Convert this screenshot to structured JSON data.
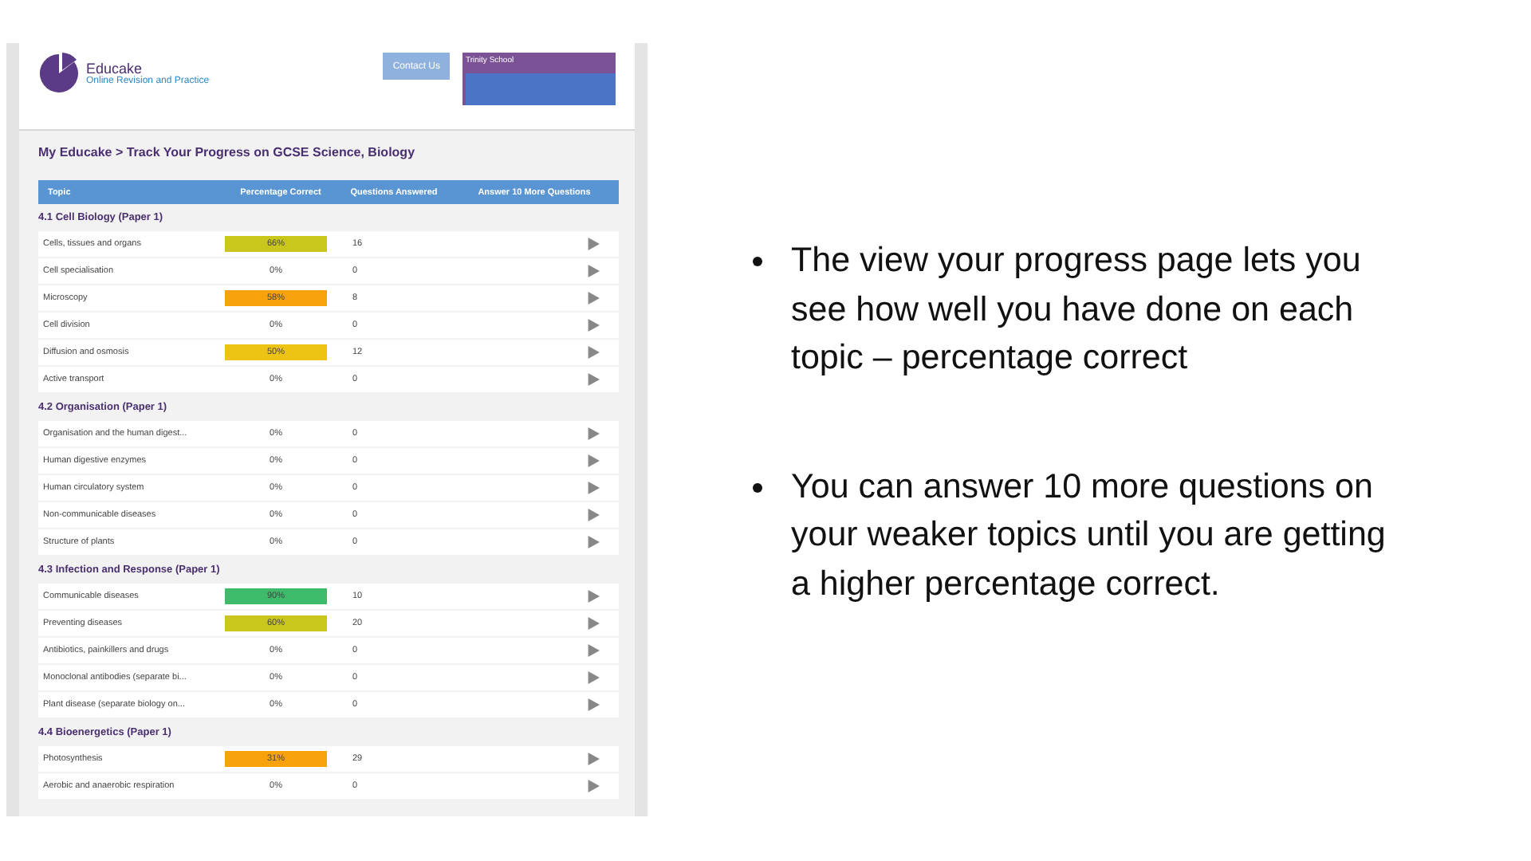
{
  "site": {
    "name": "Educake",
    "tagline": "Online Revision and Practice",
    "contact_button": "Contact Us",
    "school": "Trinity School"
  },
  "breadcrumb": "My Educake > Track Your Progress on GCSE Science, Biology",
  "table": {
    "columns": [
      "Topic",
      "Percentage Correct",
      "Questions Answered",
      "Answer 10 More Questions"
    ],
    "sections": [
      {
        "title": "4.1 Cell Biology (Paper 1)",
        "rows": [
          {
            "topic": "Cells, tissues and organs",
            "percent": "66%",
            "answered": "16",
            "color": "#c9c61c"
          },
          {
            "topic": "Cell specialisation",
            "percent": "0%",
            "answered": "0"
          },
          {
            "topic": "Microscopy",
            "percent": "58%",
            "answered": "8",
            "color": "#f7a20c"
          },
          {
            "topic": "Cell division",
            "percent": "0%",
            "answered": "0"
          },
          {
            "topic": "Diffusion and osmosis",
            "percent": "50%",
            "answered": "12",
            "color": "#eec414"
          },
          {
            "topic": "Active transport",
            "percent": "0%",
            "answered": "0"
          }
        ]
      },
      {
        "title": "4.2 Organisation (Paper 1)",
        "rows": [
          {
            "topic": "Organisation and the human digest...",
            "percent": "0%",
            "answered": "0"
          },
          {
            "topic": "Human digestive enzymes",
            "percent": "0%",
            "answered": "0"
          },
          {
            "topic": "Human circulatory system",
            "percent": "0%",
            "answered": "0"
          },
          {
            "topic": "Non-communicable diseases",
            "percent": "0%",
            "answered": "0"
          },
          {
            "topic": "Structure of plants",
            "percent": "0%",
            "answered": "0"
          }
        ]
      },
      {
        "title": "4.3 Infection and Response (Paper 1)",
        "rows": [
          {
            "topic": "Communicable diseases",
            "percent": "90%",
            "answered": "10",
            "color": "#3dba6a"
          },
          {
            "topic": "Preventing diseases",
            "percent": "60%",
            "answered": "20",
            "color": "#c9c61c"
          },
          {
            "topic": "Antibiotics, painkillers and drugs",
            "percent": "0%",
            "answered": "0"
          },
          {
            "topic": "Monoclonal antibodies (separate bi...",
            "percent": "0%",
            "answered": "0"
          },
          {
            "topic": "Plant disease (separate biology on...",
            "percent": "0%",
            "answered": "0"
          }
        ]
      },
      {
        "title": "4.4 Bioenergetics (Paper 1)",
        "rows": [
          {
            "topic": "Photosynthesis",
            "percent": "31%",
            "answered": "29",
            "color": "#f7a20c"
          },
          {
            "topic": "Aerobic and anaerobic respiration",
            "percent": "0%",
            "answered": "0"
          }
        ]
      }
    ]
  },
  "bullets": [
    "The view your progress page lets you see how well you have done on each topic – percentage correct",
    "You can answer 10 more questions on your weaker topics until you are getting a higher percentage correct."
  ]
}
